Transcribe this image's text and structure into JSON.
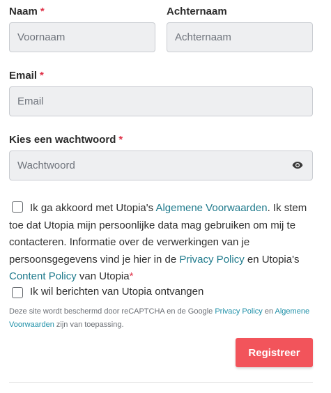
{
  "form": {
    "first_name": {
      "label": "Naam",
      "required": "*",
      "placeholder": "Voornaam"
    },
    "last_name": {
      "label": "Achternaam",
      "placeholder": "Achternaam"
    },
    "email": {
      "label": "Email",
      "required": "*",
      "placeholder": "Email"
    },
    "password": {
      "label": "Kies een wachtwoord",
      "required": "*",
      "placeholder": "Wachtwoord",
      "toggle_icon": "eye-icon"
    },
    "consent": {
      "part1": "Ik ga akkoord met Utopia's ",
      "link_terms": "Algemene Voorwaarden",
      "part2": ". Ik stem toe dat Utopia mijn persoonlijke data mag gebruiken om mij te contacteren. Informatie over de verwerkingen van je persoonsgegevens vind je hier in de ",
      "link_privacy": "Privacy Policy",
      "part3": " en Utopia's ",
      "link_content": "Content Policy",
      "part4": " van Utopia",
      "required": "*"
    },
    "newsletter": {
      "label": "Ik wil berichten van Utopia ontvangen"
    },
    "captcha": {
      "part1": "Deze site wordt beschermd door reCAPTCHA en de Google ",
      "link_privacy": "Privacy Policy",
      "part2": " en ",
      "link_terms": "Algemene Voorwaarden",
      "part3": " zijn van toepassing."
    },
    "submit_label": "Registreer"
  },
  "colors": {
    "accent": "#f2545b",
    "link": "#1f7a8c",
    "required": "#e0344a",
    "field_bg": "#eeeff1"
  }
}
